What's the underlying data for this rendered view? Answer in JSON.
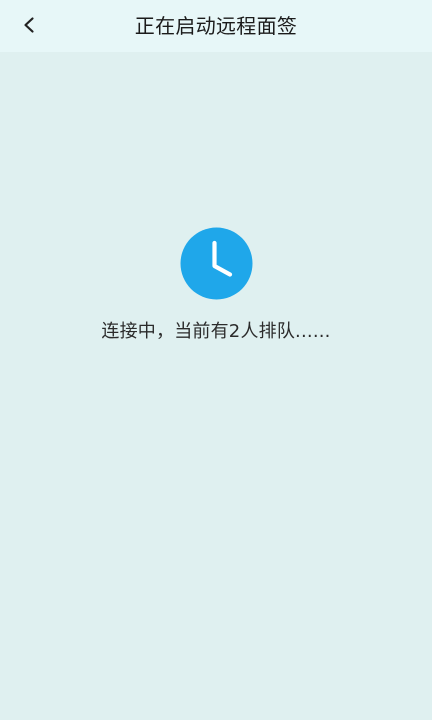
{
  "header": {
    "title": "正在启动远程面签",
    "back_icon": "chevron-left-icon"
  },
  "main": {
    "status_icon": "clock-icon",
    "status_text": "连接中，当前有2人排队......"
  },
  "colors": {
    "header_bg": "#e7f7f8",
    "page_bg": "#dff0f0",
    "clock_blue": "#1fa7ea"
  }
}
